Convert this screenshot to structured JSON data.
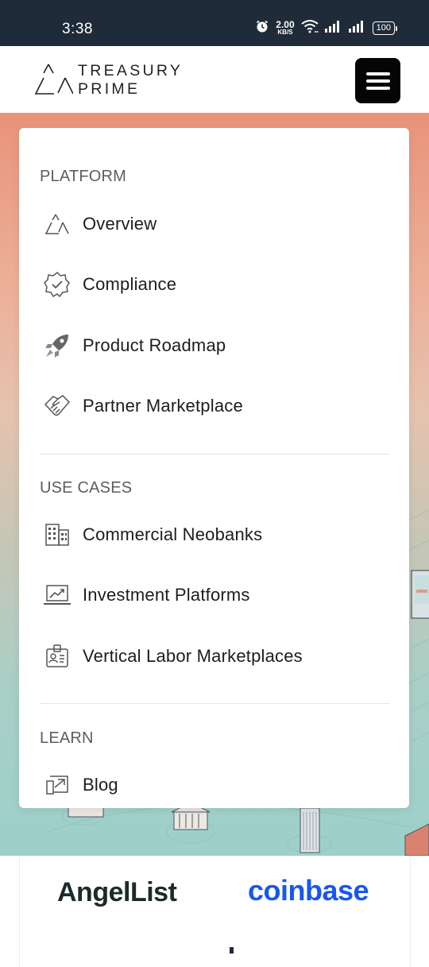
{
  "status_bar": {
    "time": "3:38",
    "net_speed_value": "2.00",
    "net_speed_unit": "KB/S",
    "battery": "100",
    "icons": [
      "alarm-icon",
      "wifi-icon",
      "signal-icon",
      "signal-icon",
      "battery-icon"
    ]
  },
  "header": {
    "logo_line1": "TREASURY",
    "logo_line2": "PRIME",
    "menu_icon": "hamburger-icon"
  },
  "menu": {
    "sections": [
      {
        "title": "PLATFORM",
        "items": [
          {
            "label": "Overview",
            "icon": "triangle-logo-icon"
          },
          {
            "label": "Compliance",
            "icon": "badge-check-icon"
          },
          {
            "label": "Product Roadmap",
            "icon": "rocket-icon"
          },
          {
            "label": "Partner Marketplace",
            "icon": "handshake-icon"
          }
        ]
      },
      {
        "title": "USE CASES",
        "items": [
          {
            "label": "Commercial Neobanks",
            "icon": "building-icon"
          },
          {
            "label": "Investment Platforms",
            "icon": "chart-laptop-icon"
          },
          {
            "label": "Vertical Labor Marketplaces",
            "icon": "id-badge-icon"
          }
        ]
      },
      {
        "title": "LEARN",
        "items": [
          {
            "label": "Blog",
            "icon": "blog-icon"
          }
        ]
      }
    ]
  },
  "logos": {
    "angellist": "AngelList",
    "coinbase": "coinbase"
  },
  "colors": {
    "status_bar_bg": "#1f2b38",
    "menu_button_bg": "#050505",
    "coinbase_blue": "#1756f0",
    "hero_top": "#e8937a",
    "hero_bottom": "#9cd0ca"
  }
}
